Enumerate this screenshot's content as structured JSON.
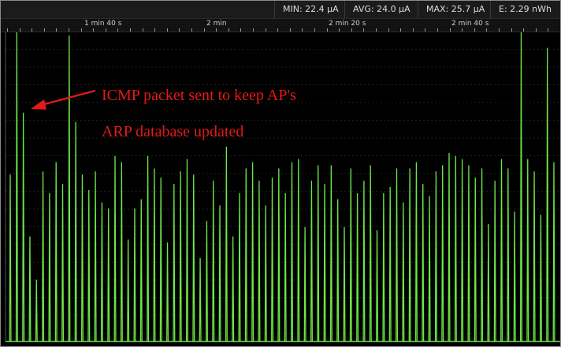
{
  "stats": {
    "min": "MIN: 22.4 µA",
    "avg": "AVG: 24.0 µA",
    "max": "MAX: 25.7 µA",
    "energy": "E: 2.29 nWh"
  },
  "colors": {
    "trace": "#6ee648",
    "annotation": "#e31919",
    "background": "#000000",
    "grid": "#3c3c3c"
  },
  "annotation": {
    "line1": "ICMP packet sent to keep AP's",
    "line2": "ARP database updated"
  },
  "chart_data": {
    "type": "line",
    "title": "",
    "xlabel": "",
    "ylabel": "",
    "x_ticks": [
      "1 min 40 s",
      "2 min",
      "2 min 20 s",
      "2 min 40 s"
    ],
    "x_tick_seconds": [
      100,
      120,
      140,
      160
    ],
    "xlim_seconds": [
      86.5,
      175.9
    ],
    "ylim_relative": [
      0,
      1
    ],
    "grid": true,
    "series": [
      {
        "spikes_relative_height": [
          0.54,
          1.0,
          0.74,
          0.34,
          0.2,
          0.55,
          0.48,
          0.58,
          0.51,
          0.99,
          0.71,
          0.54,
          0.49,
          0.55,
          0.45,
          0.43,
          0.6,
          0.58,
          0.33,
          0.43,
          0.46,
          0.6,
          0.56,
          0.53,
          0.32,
          0.51,
          0.55,
          0.59,
          0.54,
          0.27,
          0.39,
          0.52,
          0.44,
          0.63,
          0.34,
          0.48,
          0.56,
          0.58,
          0.52,
          0.44,
          0.53,
          0.56,
          0.48,
          0.58,
          0.59,
          0.37,
          0.52,
          0.57,
          0.51,
          0.57,
          0.46,
          0.37,
          0.56,
          0.48,
          0.52,
          0.57,
          0.36,
          0.48,
          0.5,
          0.56,
          0.45,
          0.56,
          0.58,
          0.51,
          0.47,
          0.55,
          0.57,
          0.61,
          0.6,
          0.59,
          0.57,
          0.53,
          0.56,
          0.38,
          0.52,
          0.59,
          0.56,
          0.42,
          1.0,
          0.59,
          0.55,
          0.41,
          0.95,
          0.58
        ]
      }
    ]
  }
}
